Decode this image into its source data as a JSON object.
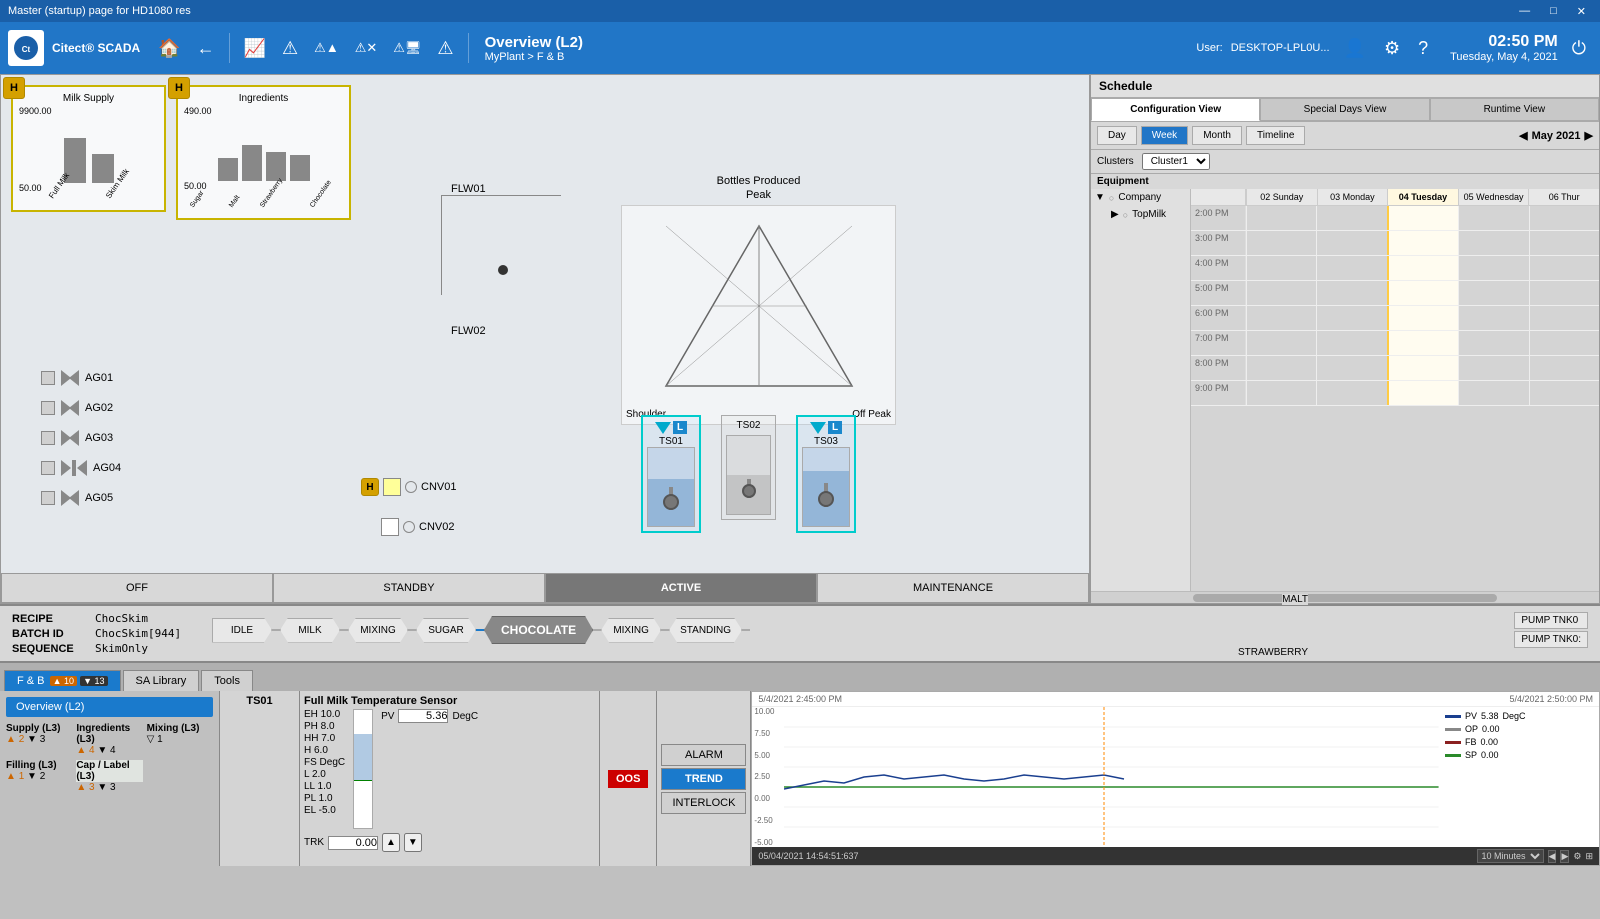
{
  "titlebar": {
    "title": "Master (startup) page for HD1080 res",
    "min": "—",
    "max": "□",
    "close": "✕"
  },
  "toolbar": {
    "app_name": "Citect® SCADA",
    "nav_title": "Overview (L2)",
    "nav_sub": "MyPlant > F & B",
    "user_label": "User:",
    "user": "DESKTOP-LPL0U...",
    "time": "02:50 PM",
    "date": "Tuesday, May 4, 2021"
  },
  "plant_view": {
    "milk_supply": {
      "title": "Milk Supply",
      "alarm": "H",
      "high_val": "9900.00",
      "low_val": "50.00",
      "bars": [
        70,
        45
      ],
      "bar_labels": [
        "Full Milk",
        "Skim Milk"
      ]
    },
    "ingredients": {
      "title": "Ingredients",
      "alarm": "H",
      "high_val": "490.00",
      "low_val": "50.00",
      "bars": [
        35,
        55,
        45,
        40
      ],
      "bar_labels": [
        "Sugar",
        "Malt",
        "Strawberry",
        "Chocolate"
      ]
    },
    "valves": [
      "AG01",
      "AG02",
      "AG03",
      "AG04",
      "AG05"
    ],
    "conveyors": [
      "CNV01",
      "CNV02"
    ],
    "flow_labels": [
      "FLW01",
      "FLW02"
    ],
    "bottles_title": "Bottles Produced",
    "peak_label": "Peak",
    "shoulder_label": "Shoulder",
    "off_peak_label": "Off Peak",
    "tanks": [
      "TS01",
      "TS02",
      "TS03"
    ]
  },
  "status_tabs": {
    "tabs": [
      "OFF",
      "STANDBY",
      "ACTIVE",
      "MAINTENANCE"
    ],
    "active": "ACTIVE"
  },
  "recipe": {
    "recipe_label": "RECIPE",
    "recipe_val": "ChocSkim",
    "batch_label": "BATCH ID",
    "batch_val": "ChocSkim[944]",
    "sequence_label": "SEQUENCE",
    "sequence_val": "SkimOnly",
    "steps": [
      "IDLE",
      "MILK",
      "MIXING",
      "SUGAR",
      "CHOCOLATE",
      "MIXING",
      "STANDING"
    ],
    "active_step": "CHOCOLATE",
    "malt_label": "MALT",
    "strawberry_label": "STRAWBERRY",
    "pump_labels": [
      "PUMP TNK0",
      "PUMP TNK0:"
    ]
  },
  "schedule": {
    "header": "Schedule",
    "tabs": [
      "Configuration View",
      "Special Days View",
      "Runtime View"
    ],
    "active_tab": "Configuration View",
    "time_nav": [
      "Day",
      "Week",
      "Month",
      "Timeline"
    ],
    "active_time": "Week",
    "month": "May 2021",
    "cluster_label": "Clusters",
    "cluster_val": "Cluster1",
    "equipment_label": "Equipment",
    "tree": {
      "company": "Company",
      "child": "TopMilk"
    },
    "days": [
      "02 Sunday",
      "03 Monday",
      "04 Tuesday",
      "05 Wednesday",
      "06 Thur"
    ],
    "times": [
      "2:00 PM",
      "3:00 PM",
      "4:00 PM",
      "5:00 PM",
      "6:00 PM",
      "7:00 PM",
      "8:00 PM",
      "9:00 PM"
    ]
  },
  "bottom_tabs": {
    "tabs": [
      "F & B",
      "SA Library",
      "Tools"
    ],
    "active": "F & B",
    "badge_up": "10",
    "badge_down": "13"
  },
  "nav": {
    "active_item": "Overview (L2)",
    "sub_items": [
      {
        "label": "Supply (L3)",
        "up": "2",
        "down": "3"
      },
      {
        "label": "Ingredients (L3)",
        "up": "4",
        "down": "4"
      },
      {
        "label": "Mixing (L3)",
        "up": "",
        "down": "1"
      },
      {
        "label": "Filling (L3)",
        "up": "1",
        "down": "2"
      },
      {
        "label": "Cap / Label (L3)",
        "up": "3",
        "down": "3"
      }
    ]
  },
  "sensor": {
    "id": "TS01",
    "name": "Full Milk Temperature Sensor",
    "oos": "OOS",
    "pv_val": "5.36",
    "pv_unit": "DegC",
    "trk_label": "TRK",
    "trk_val": "0.00",
    "levels": {
      "EH": "10.0",
      "PH": "8.0",
      "HH": "7.0",
      "H": "6.0",
      "FS_label": "FS",
      "FS_unit": "DegC",
      "L": "2.0",
      "LL": "1.0",
      "PL": "1.0",
      "EL": "-5.0"
    },
    "trend_time": "10 Minutes"
  },
  "alarm_buttons": [
    "ALARM",
    "TREND",
    "INTERLOCK"
  ],
  "active_alarm_btn": "TREND",
  "trend": {
    "legend": [
      {
        "name": "PV",
        "color": "#1a3f8f",
        "val": "5.38",
        "unit": "DegC"
      },
      {
        "name": "OP",
        "color": "#888",
        "val": "0.00"
      },
      {
        "name": "FB",
        "color": "#8b2020",
        "val": "0.00"
      },
      {
        "name": "SP",
        "color": "#2a8a2a",
        "val": "0.00"
      }
    ],
    "time_left": "5/4/2021 2:45:00 PM",
    "time_right": "5/4/2021 2:50:00 PM",
    "y_min": "-5.00",
    "y_max": "10.00",
    "status_time": "05/04/2021 14:54:51:637"
  }
}
